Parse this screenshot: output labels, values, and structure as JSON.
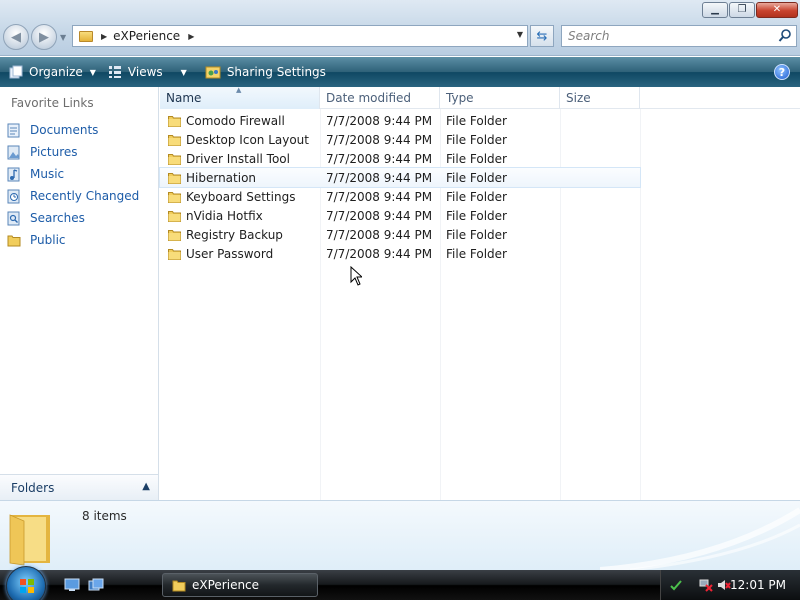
{
  "window": {
    "minimize": "▁",
    "maximize": "❐",
    "close": "✕"
  },
  "address": {
    "path": "eXPerience",
    "search_placeholder": "Search"
  },
  "toolbar": {
    "organize": "Organize",
    "views": "Views",
    "sharing": "Sharing Settings",
    "help": "?"
  },
  "sidebar": {
    "title": "Favorite Links",
    "items": [
      {
        "label": "Documents",
        "icon": "documents-icon"
      },
      {
        "label": "Pictures",
        "icon": "pictures-icon"
      },
      {
        "label": "Music",
        "icon": "music-icon"
      },
      {
        "label": "Recently Changed",
        "icon": "recently-changed-icon"
      },
      {
        "label": "Searches",
        "icon": "searches-icon"
      },
      {
        "label": "Public",
        "icon": "public-folder-icon"
      }
    ],
    "folders_label": "Folders"
  },
  "columns": {
    "name": "Name",
    "date": "Date modified",
    "type": "Type",
    "size": "Size"
  },
  "files": [
    {
      "name": "Comodo Firewall",
      "date": "7/7/2008 9:44 PM",
      "type": "File Folder"
    },
    {
      "name": "Desktop Icon Layout",
      "date": "7/7/2008 9:44 PM",
      "type": "File Folder"
    },
    {
      "name": "Driver Install Tool",
      "date": "7/7/2008 9:44 PM",
      "type": "File Folder"
    },
    {
      "name": "Hibernation",
      "date": "7/7/2008 9:44 PM",
      "type": "File Folder"
    },
    {
      "name": "Keyboard Settings",
      "date": "7/7/2008 9:44 PM",
      "type": "File Folder"
    },
    {
      "name": "nVidia Hotfix",
      "date": "7/7/2008 9:44 PM",
      "type": "File Folder"
    },
    {
      "name": "Registry Backup",
      "date": "7/7/2008 9:44 PM",
      "type": "File Folder"
    },
    {
      "name": "User Password",
      "date": "7/7/2008 9:44 PM",
      "type": "File Folder"
    }
  ],
  "details": {
    "item_count": "8 items"
  },
  "taskbar": {
    "task_label": "eXPerience",
    "clock": "12:01 PM"
  },
  "colors": {
    "link": "#1d5ca8",
    "command_bar": "#0f4863",
    "folder": "#e9bf4a"
  }
}
